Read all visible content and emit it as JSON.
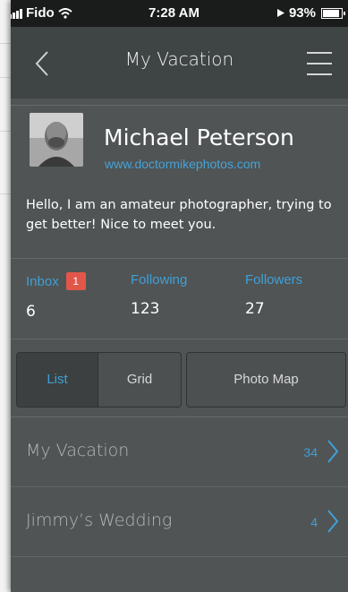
{
  "status_bar": {
    "carrier": "Fido",
    "time": "7:28 AM",
    "battery": "93%"
  },
  "nav": {
    "title": "My Vacation",
    "back_icon": "chevron-left-icon",
    "menu_icon": "hamburger-menu-icon"
  },
  "profile": {
    "name": "Michael Peterson",
    "url": "www.doctormikephotos.com",
    "bio": "Hello, I am an amateur photographer, trying to get better! Nice to meet you."
  },
  "stats": {
    "inbox_label": "Inbox",
    "inbox_badge": "1",
    "inbox_value": "6",
    "following_label": "Following",
    "following_value": "123",
    "followers_label": "Followers",
    "followers_value": "27"
  },
  "view_toggle": {
    "list_label": "List",
    "grid_label": "Grid",
    "map_label": "Photo Map",
    "selected": "List"
  },
  "albums": [
    {
      "title": "My Vacation",
      "count": "34"
    },
    {
      "title": "Jimmy’s Wedding",
      "count": "4"
    }
  ],
  "colors": {
    "accent": "#3fa0d8",
    "badge": "#e2564a",
    "background": "#505454",
    "nav_background": "#3f4444"
  }
}
